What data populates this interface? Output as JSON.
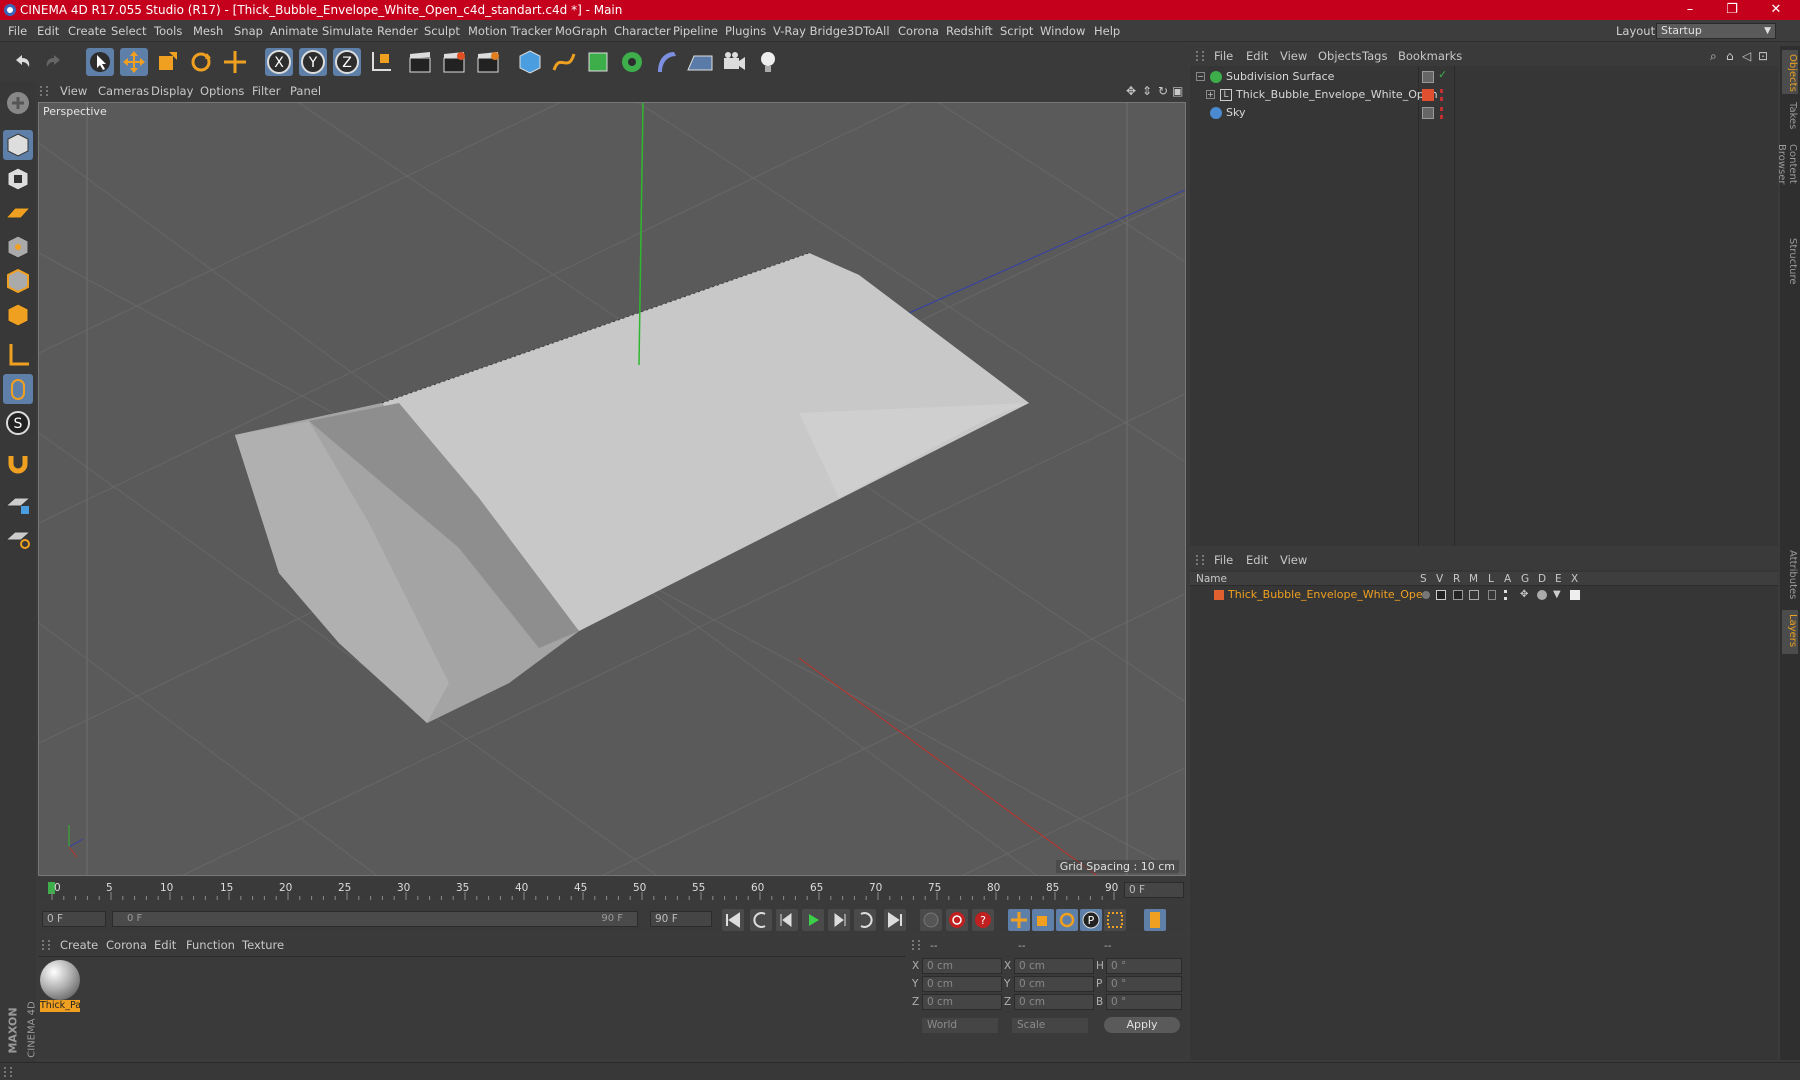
{
  "window": {
    "title": "CINEMA 4D R17.055 Studio (R17) - [Thick_Bubble_Envelope_White_Open_c4d_standart.c4d *] - Main",
    "minimize": "–",
    "maximize": "❐",
    "close": "✕"
  },
  "menubar": {
    "items": [
      "File",
      "Edit",
      "Create",
      "Select",
      "Tools",
      "Mesh",
      "Snap",
      "Animate",
      "Simulate",
      "Render",
      "Sculpt",
      "Motion Tracker",
      "MoGraph",
      "Character",
      "Pipeline",
      "Plugins",
      "V-Ray Bridge",
      "3DToAll",
      "Corona",
      "Redshift",
      "Script",
      "Window",
      "Help"
    ],
    "layout_label": "Layout:",
    "layout_value": "Startup"
  },
  "viewport": {
    "menu": [
      "View",
      "Cameras",
      "Display",
      "Options",
      "Filter",
      "Panel"
    ],
    "label": "Perspective",
    "grid_spacing": "Grid Spacing : 10 cm",
    "colors": {
      "background": "#5a5a5a",
      "y_axis": "#2fb82f",
      "x_axis": "#c0302a",
      "z_axis": "#3340a8"
    }
  },
  "timeline": {
    "ticks": [
      "0",
      "5",
      "10",
      "15",
      "20",
      "25",
      "30",
      "35",
      "40",
      "45",
      "50",
      "55",
      "60",
      "65",
      "70",
      "75",
      "80",
      "85",
      "90"
    ],
    "current_frame": "0 F"
  },
  "transport": {
    "start_frame": "0 F",
    "range_start": "0 F",
    "range_end": "90 F",
    "end_frame": "90 F"
  },
  "material_panel": {
    "menu": [
      "Create",
      "Corona",
      "Edit",
      "Function",
      "Texture"
    ],
    "material_name": "Thick_Pa"
  },
  "coordinates": {
    "headers": [
      "--",
      "--",
      "--"
    ],
    "rows": [
      {
        "a": "X",
        "av": "0 cm",
        "b": "X",
        "bv": "0 cm",
        "c": "H",
        "cv": "0 °"
      },
      {
        "a": "Y",
        "av": "0 cm",
        "b": "Y",
        "bv": "0 cm",
        "c": "P",
        "cv": "0 °"
      },
      {
        "a": "Z",
        "av": "0 cm",
        "b": "Z",
        "bv": "0 cm",
        "c": "B",
        "cv": "0 °"
      }
    ],
    "mode_world": "World",
    "mode_scale": "Scale",
    "apply": "Apply"
  },
  "object_manager": {
    "menu": [
      "File",
      "Edit",
      "View",
      "Objects",
      "Tags",
      "Bookmarks"
    ],
    "objects": [
      {
        "name": "Subdivision Surface"
      },
      {
        "name": "Thick_Bubble_Envelope_White_Open"
      },
      {
        "name": "Sky"
      }
    ]
  },
  "layer_manager": {
    "menu": [
      "File",
      "Edit",
      "View"
    ],
    "columns": [
      "Name",
      "S",
      "V",
      "R",
      "M",
      "L",
      "A",
      "G",
      "D",
      "E",
      "X"
    ],
    "layers": [
      {
        "name": "Thick_Bubble_Envelope_White_Open",
        "color": "#e06030"
      }
    ]
  },
  "side_tabs": [
    "Objects",
    "Takes",
    "Content Browser",
    "Structure",
    "Attributes",
    "Layers"
  ],
  "brand": {
    "line1": "MAXON",
    "line2": "CINEMA 4D"
  }
}
